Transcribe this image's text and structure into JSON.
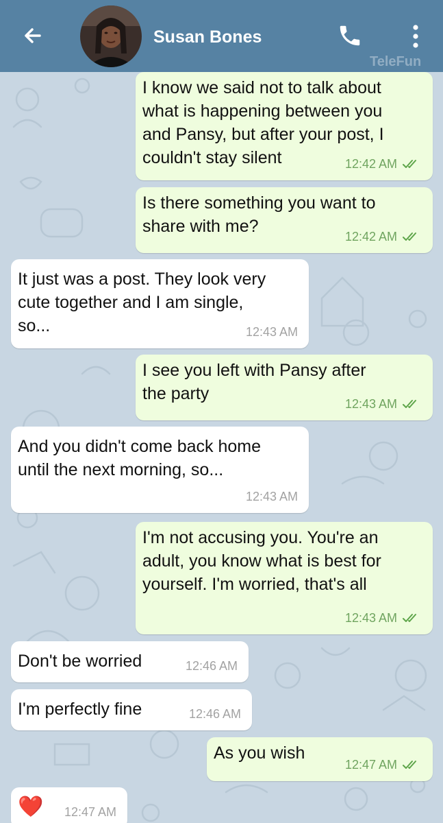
{
  "header": {
    "back_icon": "arrow-left-icon",
    "contact_name": "Susan Bones",
    "call_icon": "phone-icon",
    "more_icon": "more-vertical-icon",
    "watermark": "TeleFun",
    "bar_color": "#5682a3"
  },
  "colors": {
    "outgoing_bubble": "#effdde",
    "incoming_bubble": "#ffffff",
    "outgoing_time": "#6fa45f",
    "incoming_time": "#a2a2a2",
    "chat_background": "#c8d6e2"
  },
  "messages": [
    {
      "direction": "out",
      "text": "I know we said not to talk about\nwhat is happening between you\nand Pansy, but after your post, I\ncouldn't stay silent",
      "time": "12:42 AM",
      "read": true
    },
    {
      "direction": "out",
      "text": "Is there something you want to\nshare with me?",
      "time": "12:42 AM",
      "read": true
    },
    {
      "direction": "in",
      "text": "It just was a post. They look very\ncute together and I am single,\nso...",
      "time": "12:43 AM"
    },
    {
      "direction": "out",
      "text": "I see you left with Pansy after\nthe party",
      "time": "12:43 AM",
      "read": true
    },
    {
      "direction": "in",
      "text": "And you didn't come back home\nuntil the next morning, so...",
      "time": "12:43 AM"
    },
    {
      "direction": "out",
      "text": "I'm not accusing you. You're an\nadult, you know what is best for\nyourself. I'm worried, that's all",
      "time": "12:43 AM",
      "read": true
    },
    {
      "direction": "in",
      "text": "Don't be worried",
      "time": "12:46 AM"
    },
    {
      "direction": "in",
      "text": "I'm perfectly fine",
      "time": "12:46 AM"
    },
    {
      "direction": "out",
      "text": "As you wish",
      "time": "12:47 AM",
      "read": true
    },
    {
      "direction": "in",
      "text": "❤️",
      "time": "12:47 AM",
      "icon": "heart-icon"
    }
  ]
}
